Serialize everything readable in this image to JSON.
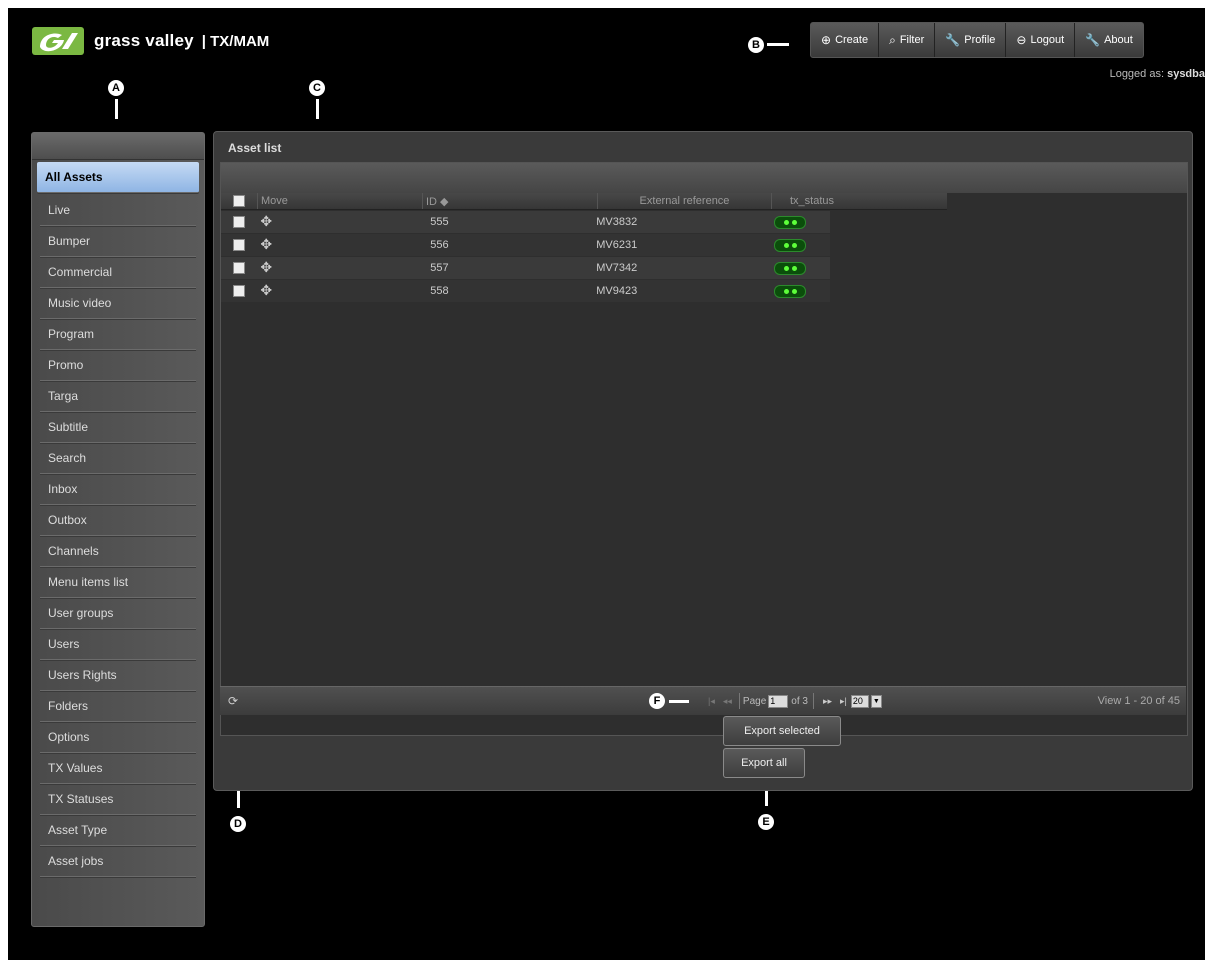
{
  "brand": {
    "name": "grass valley",
    "product": "| TX/MAM"
  },
  "topnav": [
    {
      "icon": "⊕",
      "label": "Create",
      "icon_name": "create-icon"
    },
    {
      "icon": "⌕",
      "label": "Filter",
      "icon_name": "filter-icon"
    },
    {
      "icon": "🔧",
      "label": "Profile",
      "icon_name": "wrench-icon"
    },
    {
      "icon": "⊖",
      "label": "Logout",
      "icon_name": "logout-icon"
    },
    {
      "icon": "🔧",
      "label": "About",
      "icon_name": "wrench-icon"
    }
  ],
  "logged": {
    "prefix": "Logged as:",
    "user": "sysdba"
  },
  "sidebar": {
    "items": [
      "All Assets",
      "Live",
      "Bumper",
      "Commercial",
      "Music video",
      "Program",
      "Promo",
      "Targa",
      "Subtitle",
      "Search",
      "Inbox",
      "Outbox",
      "Channels",
      "Menu items list",
      "User groups",
      "Users",
      "Users Rights",
      "Folders",
      "Options",
      "TX Values",
      "TX Statuses",
      "Asset Type",
      "Asset jobs"
    ],
    "active_index": 0
  },
  "panel": {
    "title": "Asset list"
  },
  "grid": {
    "columns": [
      "Move",
      "ID ◆",
      "External reference",
      "tx_status"
    ],
    "rows": [
      {
        "id": "555",
        "ref": "MV3832"
      },
      {
        "id": "556",
        "ref": "MV6231"
      },
      {
        "id": "557",
        "ref": "MV7342"
      },
      {
        "id": "558",
        "ref": "MV9423"
      }
    ]
  },
  "pager": {
    "page_label": "Page",
    "page_value": "1",
    "of_label": "of 3",
    "page_size": "20",
    "view_text": "View 1 - 20 of 45"
  },
  "buttons": {
    "export_selected": "Export selected",
    "export_all": "Export all"
  },
  "callouts": {
    "a": "A",
    "b": "B",
    "c": "C",
    "d": "D",
    "e": "E",
    "f": "F"
  },
  "colors": {
    "logo_green": "#7bb842",
    "active_item": "#a9c8ee",
    "status_led": "#5dff3a"
  }
}
